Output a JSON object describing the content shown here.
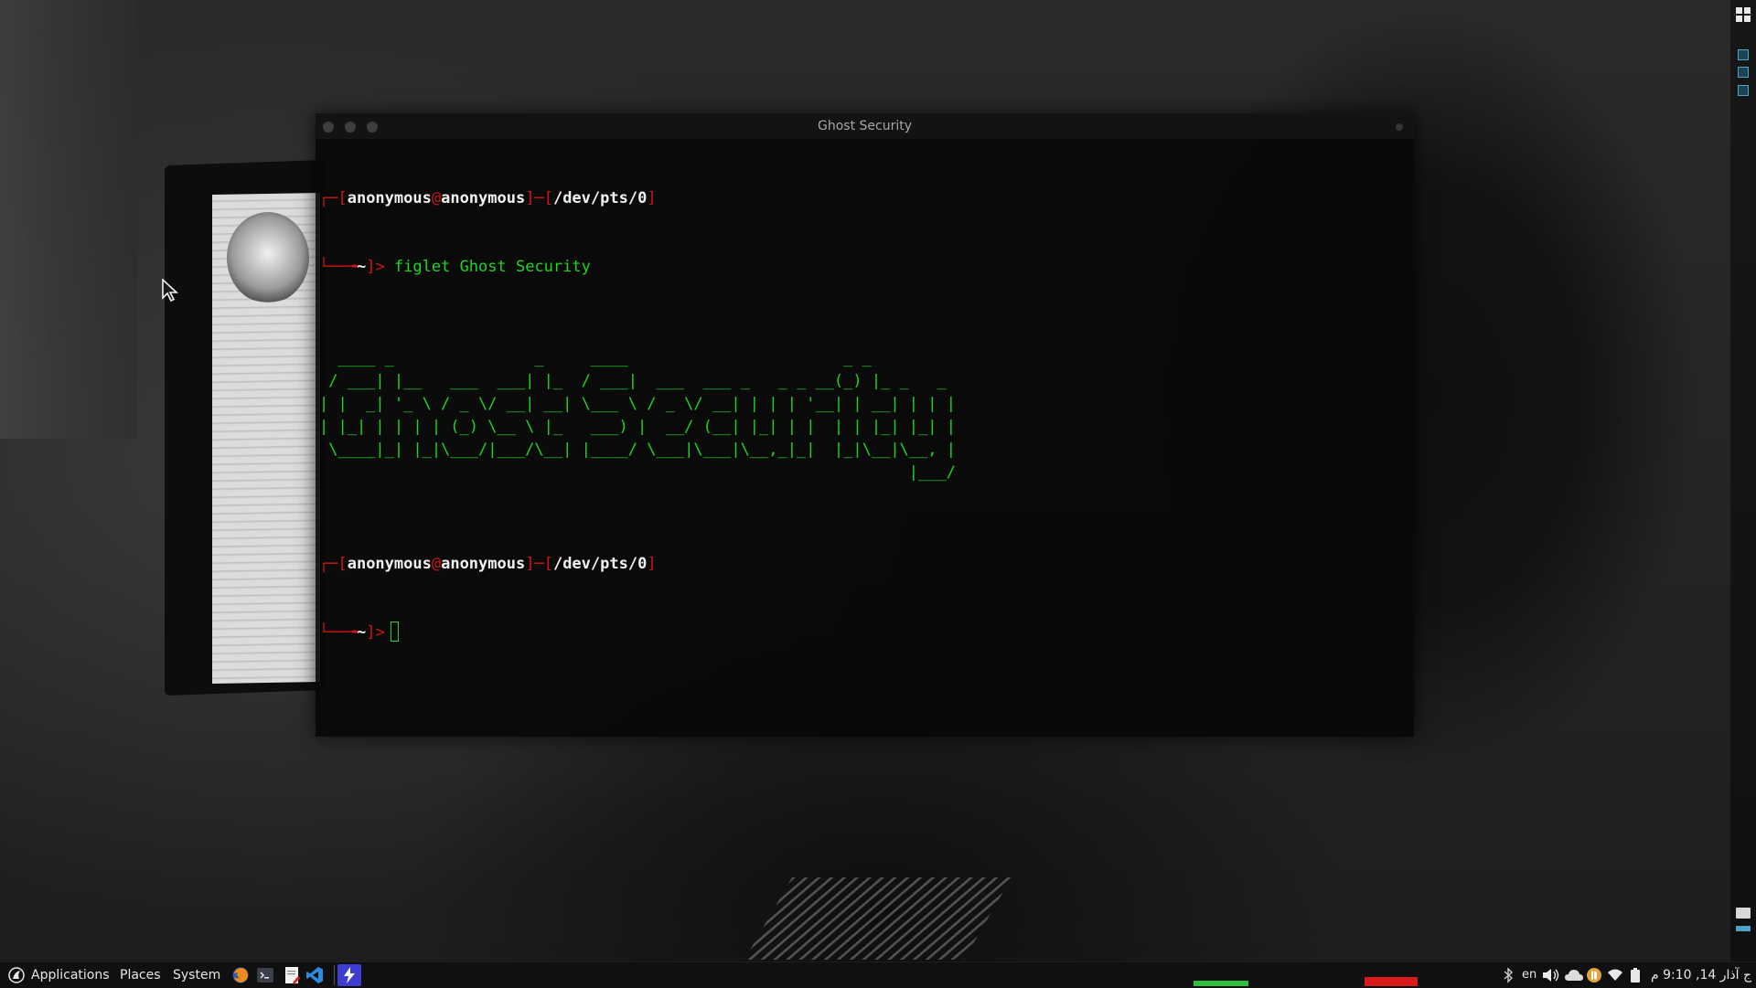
{
  "terminal": {
    "title": "Ghost Security",
    "lines": [
      {
        "user": "anonymous",
        "at": "@",
        "host": "anonymous",
        "tty": "/dev/pts/0"
      },
      {
        "dir": "~",
        "command": "figlet Ghost Security"
      },
      {
        "dir": "~"
      }
    ],
    "ascii_art": [
      "  ____ _               _     ____                       _ _",
      " / ___| |__   ___  ___| |_  / ___|  ___  ___ _   _ _ __(_) |_ _   _",
      "| |  _| '_ \\ / _ \\/ __| __| \\___ \\ / _ \\/ __| | | | '__| | __| | | |",
      "| |_| | | | | (_) \\__ \\ |_   ___) |  __/ (__| |_| | |  | | |_| |_| |",
      " \\____|_| |_|\\___/|___/\\__| |____/ \\___|\\___|\\__,_|_|  |_|\\__|\\__, |",
      "                                                               |___/"
    ]
  },
  "taskbar": {
    "applications_label": "Applications",
    "places_label": "Places",
    "system_label": "System",
    "keyboard_layout": "en",
    "clock": "ج آذار 14, 9:10 م"
  },
  "colors": {
    "prompt_red": "#d01616",
    "terminal_green": "#1fd51f",
    "window_indicator_green": "#2fbf3f",
    "window_indicator_red": "#d81a1a"
  },
  "icons": {
    "menu": "kali-dragon-icon",
    "launchers": [
      "firefox-icon",
      "terminal-icon",
      "text-editor-icon",
      "vscode-icon",
      "burp-suite-icon"
    ],
    "tray": [
      "bluetooth-icon",
      "volume-icon",
      "cloud-icon",
      "pushbullet-icon",
      "wifi-icon",
      "battery-icon"
    ]
  }
}
